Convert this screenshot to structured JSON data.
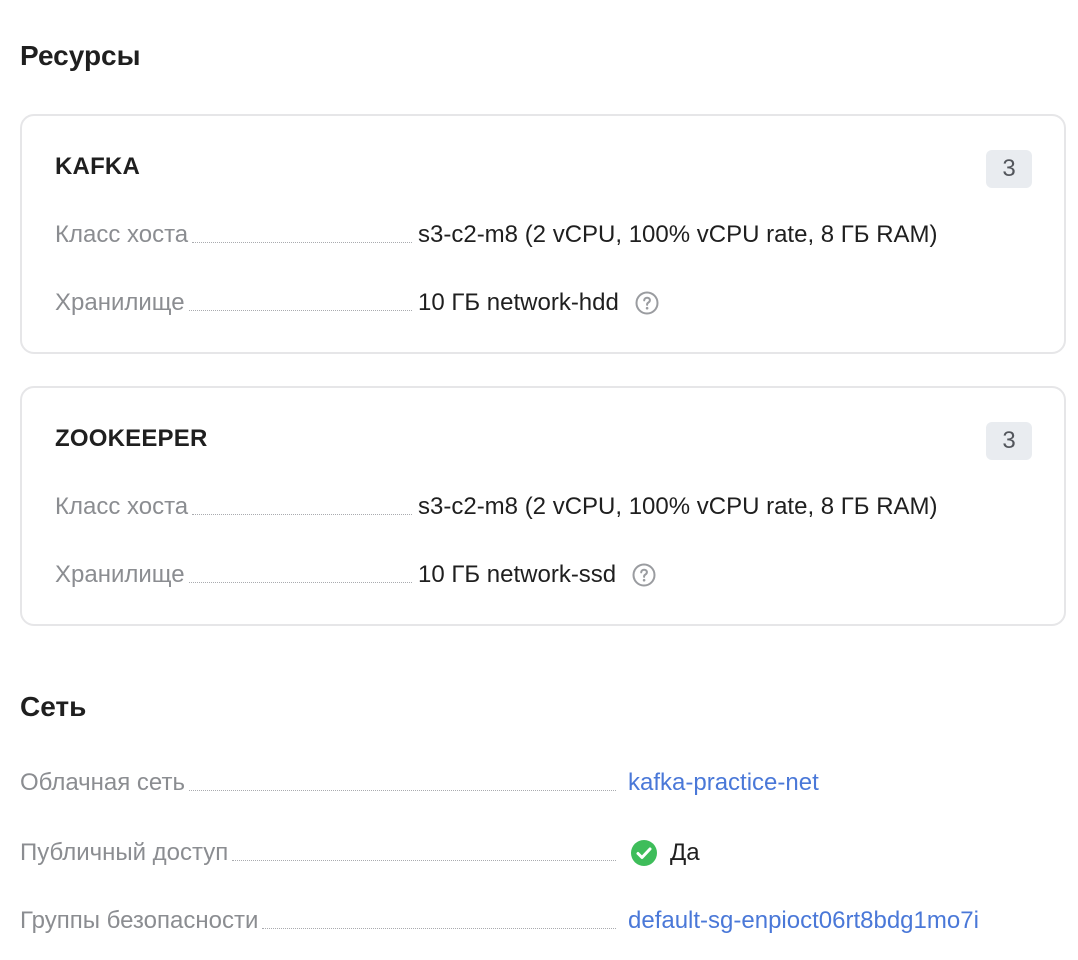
{
  "resources": {
    "title": "Ресурсы",
    "kafka": {
      "title": "KAFKA",
      "count": "3",
      "host_class_label": "Класс хоста",
      "host_class_value": "s3-c2-m8 (2 vCPU, 100% vCPU rate, 8 ГБ RAM)",
      "storage_label": "Хранилище",
      "storage_value": "10 ГБ network-hdd"
    },
    "zookeeper": {
      "title": "ZOOKEEPER",
      "count": "3",
      "host_class_label": "Класс хоста",
      "host_class_value": "s3-c2-m8 (2 vCPU, 100% vCPU rate, 8 ГБ RAM)",
      "storage_label": "Хранилище",
      "storage_value": "10 ГБ network-ssd"
    }
  },
  "network": {
    "title": "Сеть",
    "cloud_network_label": "Облачная сеть",
    "cloud_network_value": "kafka-practice-net",
    "public_access_label": "Публичный доступ",
    "public_access_value": "Да",
    "security_groups_label": "Группы безопасности",
    "security_groups_value": "default-sg-enpioct06rt8bdg1mo7i"
  },
  "colors": {
    "link": "#4a78d8",
    "success": "#3ebd5a",
    "muted_label": "#8b8d91"
  },
  "icons": {
    "help": "question-circle-icon",
    "success": "check-circle-icon"
  }
}
